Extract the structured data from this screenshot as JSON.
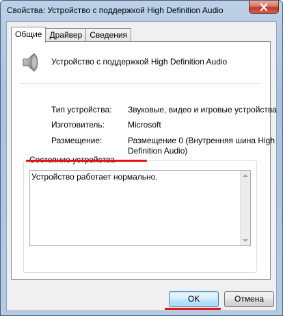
{
  "window": {
    "title": "Свойства: Устройство с поддержкой High Definition Audio"
  },
  "tabs": [
    {
      "label": "Общие",
      "active": true
    },
    {
      "label": "Драйвер",
      "active": false
    },
    {
      "label": "Сведения",
      "active": false
    }
  ],
  "device": {
    "icon": "speaker-icon",
    "name": "Устройство с поддержкой High Definition Audio"
  },
  "properties": {
    "type_label": "Тип устройства:",
    "type_value": "Звуковые, видео и игровые устройства",
    "manufacturer_label": "Изготовитель:",
    "manufacturer_value": "Microsoft",
    "location_label": "Размещение:",
    "location_value_line1": "Размещение 0 (Внутренняя шина High",
    "location_value_line2": "Definition Audio)"
  },
  "status": {
    "legend": "Состояние устройства",
    "text": "Устройство работает нормально."
  },
  "buttons": {
    "ok": "OK",
    "cancel": "Отмена"
  },
  "colors": {
    "highlight_red": "#e11515",
    "close_button": "#c0392b"
  }
}
